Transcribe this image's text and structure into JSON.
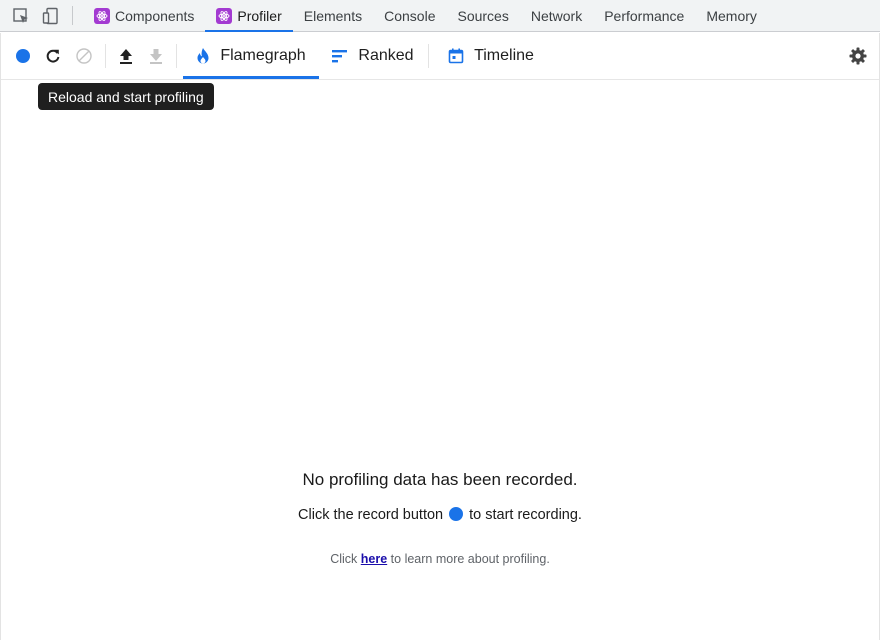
{
  "devtools_tabs": [
    {
      "label": "Components",
      "icon": "react-icon",
      "active": false
    },
    {
      "label": "Profiler",
      "icon": "react-icon",
      "active": true
    },
    {
      "label": "Elements",
      "active": false
    },
    {
      "label": "Console",
      "active": false
    },
    {
      "label": "Sources",
      "active": false
    },
    {
      "label": "Network",
      "active": false
    },
    {
      "label": "Performance",
      "active": false
    },
    {
      "label": "Memory",
      "active": false
    }
  ],
  "toolbar": {
    "view_tabs": [
      {
        "label": "Flamegraph",
        "icon": "flame-icon",
        "active": true
      },
      {
        "label": "Ranked",
        "icon": "ranked-bars-icon",
        "active": false
      },
      {
        "label": "Timeline",
        "icon": "calendar-icon",
        "active": false
      }
    ],
    "icons": [
      "record-icon",
      "reload-icon",
      "clear-icon",
      "upload-icon",
      "download-icon",
      "gear-icon"
    ]
  },
  "tooltip": {
    "text": "Reload and start profiling"
  },
  "empty_state": {
    "title": "No profiling data has been recorded.",
    "hint_before": "Click the record button",
    "hint_after": "to start recording.",
    "learn_prefix": "Click",
    "learn_link": "here",
    "learn_suffix": "to learn more about profiling."
  },
  "colors": {
    "accent": "#1a73e8",
    "react_badge": "#a33ad1",
    "tooltip_bg": "#1f1f1f"
  }
}
